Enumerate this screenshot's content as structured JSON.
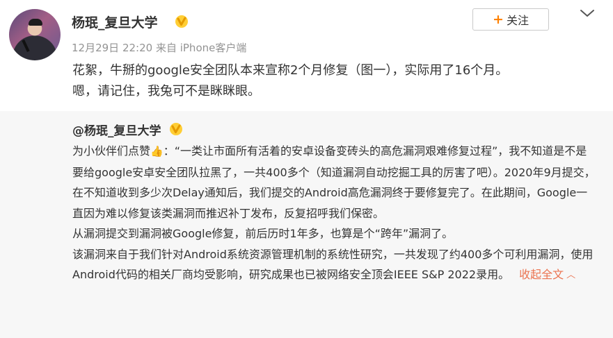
{
  "author": {
    "name": "杨珉_复旦大学",
    "verified_icon": "verified-v-badge-icon",
    "avatar_icon": "user-avatar"
  },
  "meta": {
    "timestamp": "12月29日 22:20",
    "source": "来自 iPhone客户端"
  },
  "actions": {
    "follow_label": "关注",
    "follow_icon": "plus-icon",
    "menu_icon": "chevron-down-icon"
  },
  "post": {
    "line1": "花絮，牛掰的google安全团队本来宣称2个月修复（图一），实际用了16个月。",
    "line2": "嗯，请记住，我兔可不是眯眯眼。"
  },
  "quoted": {
    "author": "@杨珉_复旦大学",
    "p1_prefix": "为小伙伴们点赞",
    "p1_rest": "：“一类让市面所有活着的安卓设备变砖头的高危漏洞艰难修复过程”，我不知道是不是要给google安卓安全团队拉黑了，一共400多个（知道漏洞自动挖掘工具的厉害了吧）。2020年9月提交，在不知道收到多少次Delay通知后，我们提交的Android高危漏洞终于要修复完了。在此期间，Google一直因为难以修复该类漏洞而推迟补丁发布，反复招呼我们保密。",
    "p2": "从漏洞提交到漏洞被Google修复，前后历时1年多，也算是个“跨年”漏洞了。",
    "p3": "该漏洞来自于我们针对Android系统资源管理机制的系统性研究，一共发现了约400多个可利用漏洞，使用Android代码的相关厂商均受影响，研究成果也已被网络安全顶会IEEE S&P 2022录用。",
    "collapse_label": "收起全文",
    "collapse_icon": "chevron-up-icon"
  },
  "colors": {
    "accent_orange": "#ff8200",
    "verified_gold": "#f5a800",
    "link_orange": "#eb7350",
    "quote_bg": "#f7f7f7"
  }
}
